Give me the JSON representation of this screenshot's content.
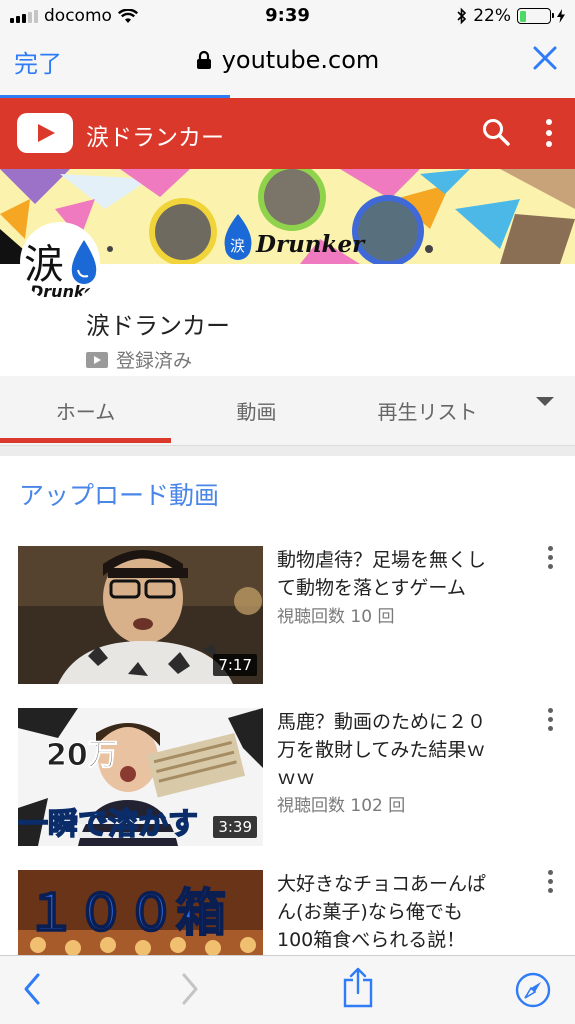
{
  "status_bar": {
    "carrier": "docomo",
    "time": "9:39",
    "battery_percent": "22%",
    "battery_level": 0.22,
    "signal_bars_active": 3,
    "signal_bars_total": 5
  },
  "safari": {
    "done_label": "完了",
    "url": "youtube.com",
    "load_progress": 0.4
  },
  "youtube_header": {
    "channel_title": "涙ドランカー"
  },
  "banner": {
    "text": "Drunker",
    "kanji": "涙"
  },
  "channel": {
    "avatar_kanji": "涙",
    "avatar_sub": "Drunke",
    "name": "涙ドランカー",
    "subscribe_status": "登録済み"
  },
  "tabs": [
    {
      "label": "ホーム",
      "active": true
    },
    {
      "label": "動画",
      "active": false
    },
    {
      "label": "再生リスト",
      "active": false
    }
  ],
  "section_title": "アップロード動画",
  "videos": [
    {
      "title_lines": [
        "動物虐待？足場を無くし",
        "て動物を落とすゲーム"
      ],
      "views": "視聴回数 10 回",
      "duration": "7:17"
    },
    {
      "title_lines": [
        "馬鹿？動画のために２０",
        "万を散財してみた結果ｗ",
        "ｗｗ"
      ],
      "views": "視聴回数 102 回",
      "duration": "3:39",
      "thumb_text_top": "20万",
      "thumb_text_bottom": "一瞬で溶かす"
    },
    {
      "title_lines": [
        "大好きなチョコあーんぱ",
        "ん(お菓子)なら俺でも",
        "100箱食べられる説！"
      ],
      "thumb_text": "１００箱"
    }
  ],
  "colors": {
    "youtube_red": "#d9382a",
    "ios_blue": "#2f7cf6",
    "section_blue": "#4a86e8"
  },
  "icons": {
    "back": "chevron-left-icon",
    "forward": "chevron-right-icon",
    "share": "share-icon",
    "safari": "compass-icon"
  }
}
